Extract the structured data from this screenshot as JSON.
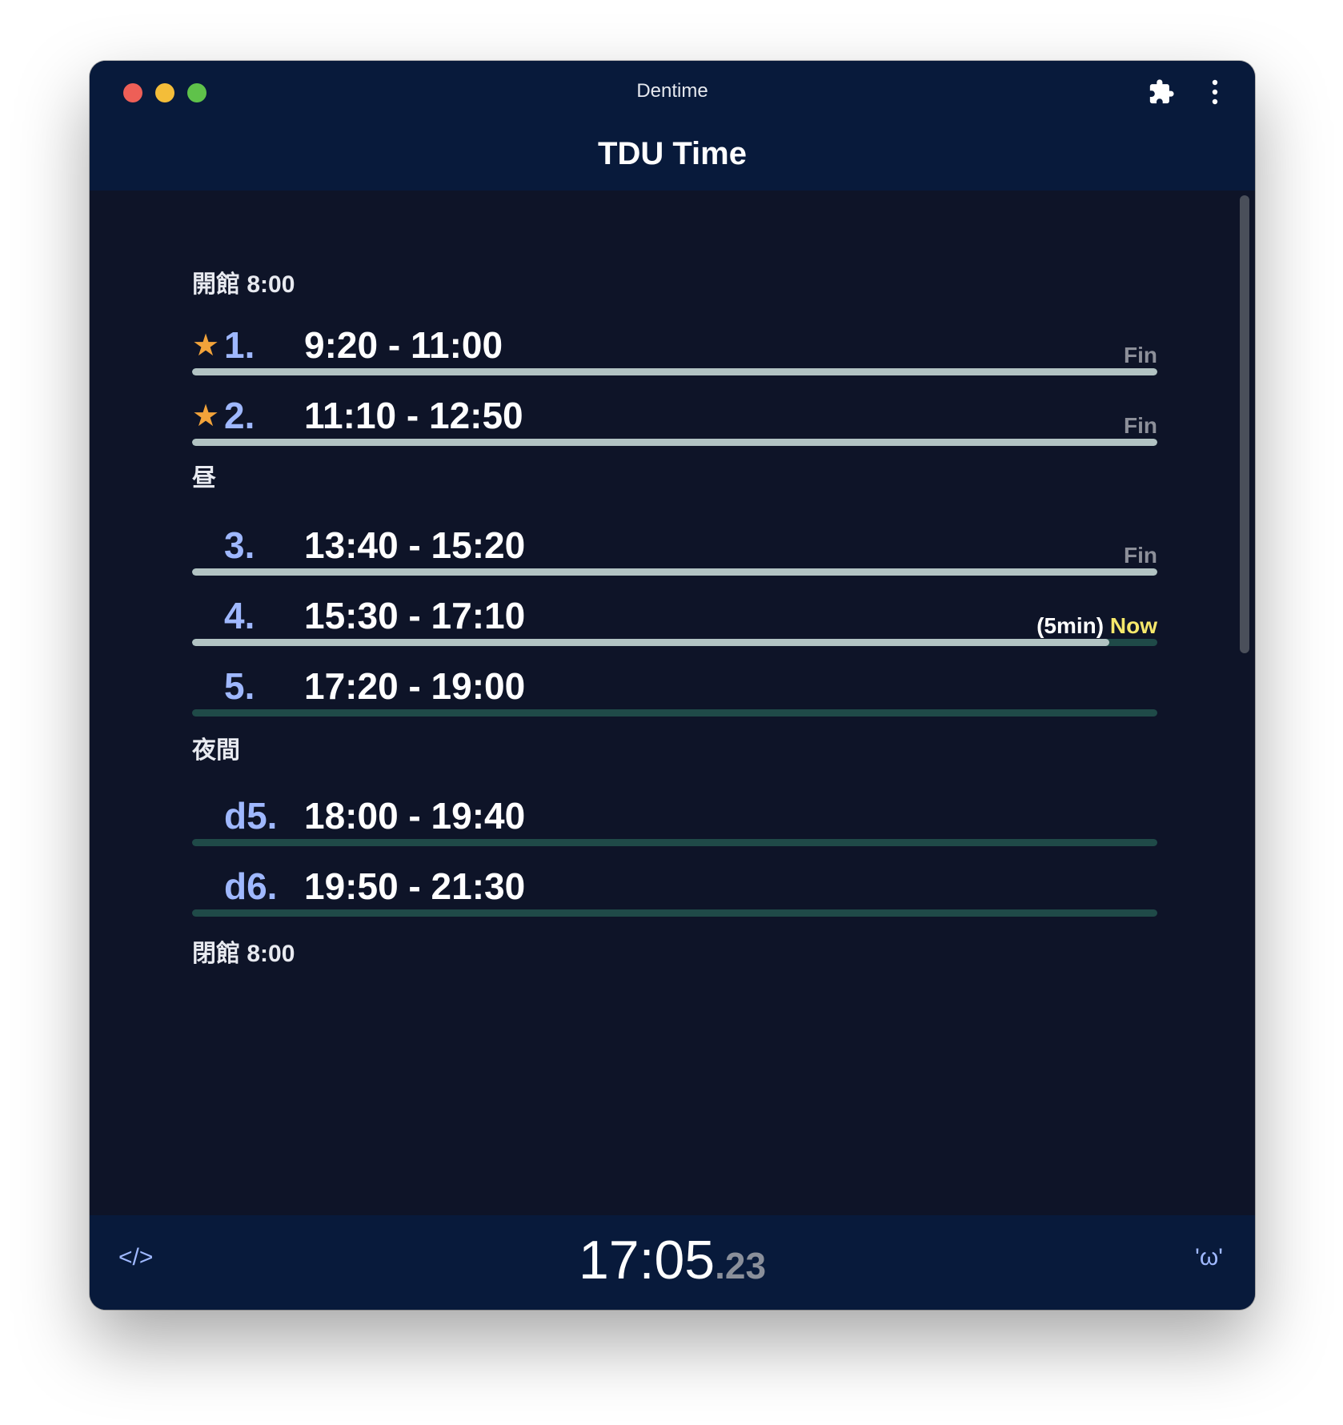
{
  "window": {
    "title": "Dentime",
    "app_title": "TDU Time"
  },
  "schedule": {
    "open_label": "開館 8:00",
    "lunch_label": "昼",
    "night_label": "夜間",
    "close_label": "閉館 8:00",
    "periods": [
      {
        "num": "1.",
        "range": "9:20 - 11:00",
        "starred": true,
        "status": "Fin",
        "progress": 1.0
      },
      {
        "num": "2.",
        "range": "11:10 - 12:50",
        "starred": true,
        "status": "Fin",
        "progress": 1.0
      },
      {
        "num": "3.",
        "range": "13:40 - 15:20",
        "starred": false,
        "status": "Fin",
        "progress": 1.0
      },
      {
        "num": "4.",
        "range": "15:30 - 17:10",
        "starred": false,
        "remaining": "(5min)",
        "status": "Now",
        "progress": 0.95
      },
      {
        "num": "5.",
        "range": "17:20 - 19:00",
        "starred": false,
        "status": "",
        "progress": 0
      },
      {
        "num": "d5.",
        "range": "18:00 - 19:40",
        "starred": false,
        "status": "",
        "progress": 0
      },
      {
        "num": "d6.",
        "range": "19:50 - 21:30",
        "starred": false,
        "status": "",
        "progress": 0
      }
    ]
  },
  "footer": {
    "code_icon": "</>",
    "clock_main": "17:05",
    "clock_fraction": ".23",
    "face": "'ω'"
  },
  "icons": {
    "star": "★",
    "extensions": "puzzle-icon",
    "menu": "kebab-menu-icon"
  },
  "colors": {
    "accent_blue": "#9fb8ff",
    "star": "#f2a33a",
    "now": "#f6e86b",
    "bar_track": "#1f4a48",
    "bar_fill": "#b2c3c3"
  }
}
